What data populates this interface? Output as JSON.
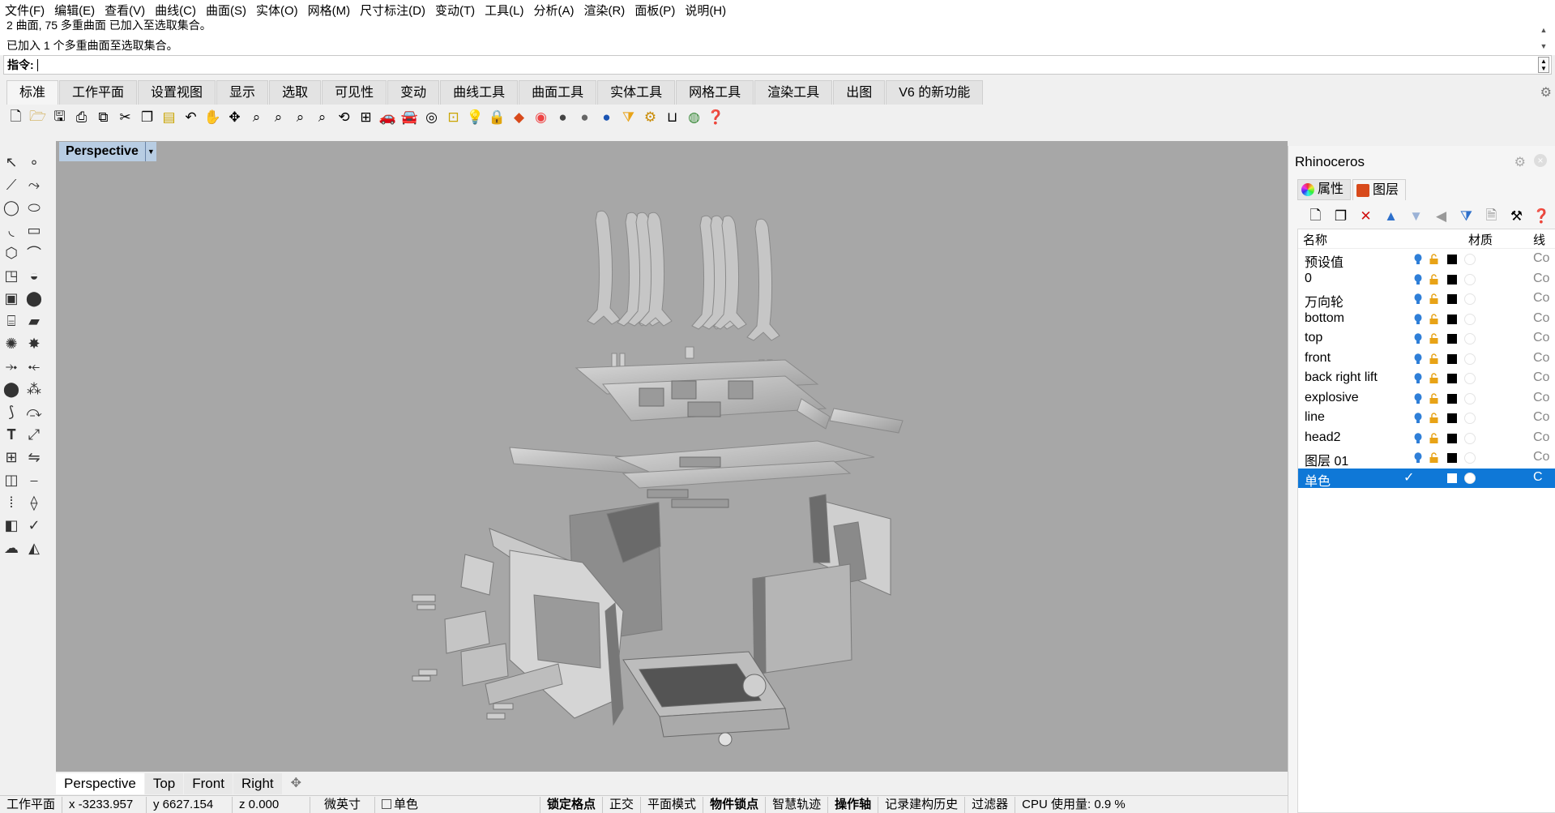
{
  "menu": [
    "文件(F)",
    "编辑(E)",
    "查看(V)",
    "曲线(C)",
    "曲面(S)",
    "实体(O)",
    "网格(M)",
    "尺寸标注(D)",
    "变动(T)",
    "工具(L)",
    "分析(A)",
    "渲染(R)",
    "面板(P)",
    "说明(H)"
  ],
  "history": {
    "line1": "2 曲面, 75 多重曲面 已加入至选取集合。",
    "line2": "已加入 1 个多重曲面至选取集合。"
  },
  "command": {
    "label": "指令:",
    "value": ""
  },
  "tabs": [
    "标准",
    "工作平面",
    "设置视图",
    "显示",
    "选取",
    "可见性",
    "变动",
    "曲线工具",
    "曲面工具",
    "实体工具",
    "网格工具",
    "渲染工具",
    "出图",
    "V6 的新功能"
  ],
  "active_tab": "标准",
  "toolbar_icons": [
    "new-file-icon",
    "open-folder-icon",
    "save-icon",
    "print-icon",
    "import-icon",
    "cut-icon",
    "copy-icon",
    "paste-icon",
    "undo-icon",
    "pan-hand-icon",
    "move-view-icon",
    "zoom-dynamic-icon",
    "zoom-window-icon",
    "zoom-extents-icon",
    "zoom-selected-icon",
    "rotate-view-icon",
    "four-views-icon",
    "car-icon",
    "car-wire-icon",
    "camera-target-icon",
    "grid-select-icon",
    "light-icon",
    "lock-icon",
    "material-icon",
    "color-wheel-icon",
    "sphere-render-icon",
    "sphere-shaded-icon",
    "sphere-blue-icon",
    "filter-icon",
    "settings-gear-icon",
    "dimension-icon",
    "globe-icon",
    "help-icon"
  ],
  "viewport": {
    "label": "Perspective",
    "tabs": [
      "Perspective",
      "Top",
      "Front",
      "Right"
    ],
    "active": "Perspective",
    "background": "#a7a7a7"
  },
  "status": {
    "cplane": "工作平面",
    "x": "x -3233.957",
    "y": "y 6627.154",
    "z": "z 0.000",
    "units": "微英寸",
    "layer": "单色",
    "grid_snap": "锁定格点",
    "ortho": "正交",
    "planar": "平面模式",
    "osnap": "物件锁点",
    "smart_track": "智慧轨迹",
    "gumball": "操作轴",
    "history": "记录建构历史",
    "filter": "过滤器",
    "cpu": "CPU 使用量: 0.9 %"
  },
  "panel": {
    "title": "Rhinoceros",
    "tabs": [
      "属性",
      "图层"
    ],
    "active_tab": "图层",
    "headers": {
      "name": "名称",
      "material": "材质",
      "linetype": "线"
    },
    "layers": [
      {
        "name": "预设值",
        "color": "#000000",
        "linetype": "Co"
      },
      {
        "name": "0",
        "color": "#000000",
        "linetype": "Co"
      },
      {
        "name": "万向轮",
        "color": "#000000",
        "linetype": "Co"
      },
      {
        "name": "bottom",
        "color": "#000000",
        "linetype": "Co"
      },
      {
        "name": "top",
        "color": "#000000",
        "linetype": "Co"
      },
      {
        "name": "front",
        "color": "#000000",
        "linetype": "Co"
      },
      {
        "name": "back right lift",
        "color": "#000000",
        "linetype": "Co"
      },
      {
        "name": "explosive",
        "color": "#000000",
        "linetype": "Co"
      },
      {
        "name": "line",
        "color": "#000000",
        "linetype": "Co"
      },
      {
        "name": "head2",
        "color": "#000000",
        "linetype": "Co"
      },
      {
        "name": "图层 01",
        "color": "#000000",
        "linetype": "Co"
      },
      {
        "name": "单色",
        "color": "#ffffff",
        "linetype": "C",
        "selected": true,
        "current": true
      }
    ]
  },
  "colors": {
    "selection": "#0f78d7",
    "viewport_label": "#b8cde3",
    "bulb": "#2f7fd8",
    "lock": "#e8a317"
  }
}
